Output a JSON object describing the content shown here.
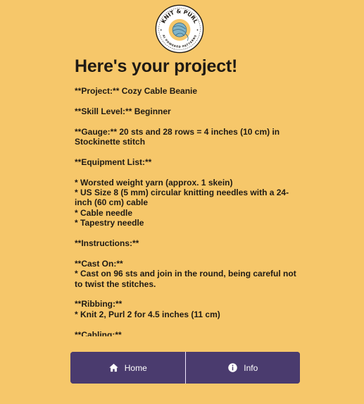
{
  "logo": {
    "name_text": "KNIT & PURL",
    "tagline_text": "AI POWERED PATTERNS",
    "colors": {
      "ring": "#1f1a14",
      "fill": "#F6C76A",
      "yarn": "#7fb3c9"
    }
  },
  "page": {
    "title": "Here's your project!"
  },
  "pattern": {
    "blocks": [
      [
        "**Project:** Cozy Cable Beanie"
      ],
      [
        "**Skill Level:** Beginner"
      ],
      [
        "**Gauge:** 20 sts and 28 rows = 4 inches (10 cm) in Stockinette stitch"
      ],
      [
        "**Equipment List:**"
      ],
      [
        "* Worsted weight yarn (approx. 1 skein)",
        "* US Size 8 (5 mm) circular knitting needles with a 24-inch (60 cm) cable",
        "* Cable needle",
        "* Tapestry needle"
      ],
      [
        "**Instructions:**"
      ],
      [
        "**Cast On:**",
        "* Cast on 96 sts and join in the round, being careful not to twist the stitches."
      ],
      [
        "**Ribbing:**",
        "* Knit 2, Purl 2 for 4.5 inches (11 cm)"
      ],
      [
        "**Cabling:**"
      ]
    ]
  },
  "nav": {
    "home_label": "Home",
    "info_label": "Info",
    "home_icon": "home-icon",
    "info_icon": "info-icon",
    "bg_color": "#4a3b6e",
    "text_color": "#ffffff"
  },
  "colors": {
    "background": "#F6C76A",
    "text": "#1f1a14"
  }
}
